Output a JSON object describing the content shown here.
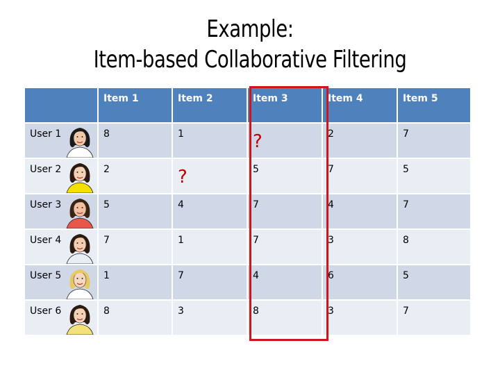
{
  "title": {
    "line1": "Example:",
    "line2": "Item-based Collaborative Filtering"
  },
  "table": {
    "corner": "",
    "columns": [
      "Item 1",
      "Item 2",
      "Item 3",
      "Item 4",
      "Item 5"
    ],
    "highlighted_column": "Item 3",
    "highlight_color": "#d0141c",
    "header_color": "#4f81bd",
    "row_colors": [
      "#d0d8e8",
      "#e9edf4"
    ],
    "missing_color": "#c00000",
    "rows": [
      {
        "user": "User 1",
        "avatar": "woman-dark-curly-hair-icon",
        "values": [
          "8",
          "1",
          "?",
          "2",
          "7"
        ]
      },
      {
        "user": "User 2",
        "avatar": "woman-smiling-yellow-top-icon",
        "values": [
          "2",
          "?",
          "5",
          "7",
          "5"
        ]
      },
      {
        "user": "User 3",
        "avatar": "woman-glasses-red-top-icon",
        "values": [
          "5",
          "4",
          "7",
          "4",
          "7"
        ]
      },
      {
        "user": "User 4",
        "avatar": "woman-wavy-hair-icon",
        "values": [
          "7",
          "1",
          "7",
          "3",
          "8"
        ]
      },
      {
        "user": "User 5",
        "avatar": "woman-blonde-sunglasses-icon",
        "values": [
          "1",
          "7",
          "4",
          "6",
          "5"
        ]
      },
      {
        "user": "User 6",
        "avatar": "woman-hair-bow-icon",
        "values": [
          "8",
          "3",
          "8",
          "3",
          "7"
        ]
      }
    ]
  }
}
